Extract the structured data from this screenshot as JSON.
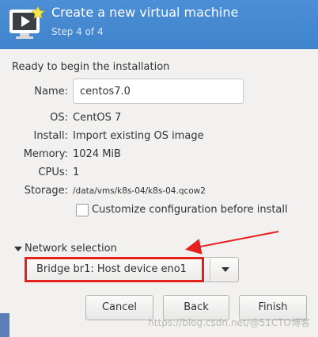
{
  "header": {
    "title": "Create a new virtual machine",
    "step": "Step 4 of 4"
  },
  "intro": "Ready to begin the installation",
  "fields": {
    "name_label": "Name:",
    "name_value": "centos7.0",
    "os_label": "OS:",
    "os_value": "CentOS 7",
    "install_label": "Install:",
    "install_value": "Import existing OS image",
    "memory_label": "Memory:",
    "memory_value": "1024 MiB",
    "cpus_label": "CPUs:",
    "cpus_value": "1",
    "storage_label": "Storage:",
    "storage_value": "/data/vms/k8s-04/k8s-04.qcow2"
  },
  "customize": {
    "label": "Customize configuration before install",
    "checked": false
  },
  "network": {
    "section_label": "Network selection",
    "selected": "Bridge br1: Host device eno1"
  },
  "buttons": {
    "cancel": "Cancel",
    "back": "Back",
    "finish": "Finish"
  },
  "annotation": {
    "highlight_color": "#e5211e"
  },
  "watermark": "https://blog.csdn.net/@51CTO博客",
  "colors": {
    "header_bg": "#4a90d9",
    "content_bg": "#f2f1f0"
  }
}
